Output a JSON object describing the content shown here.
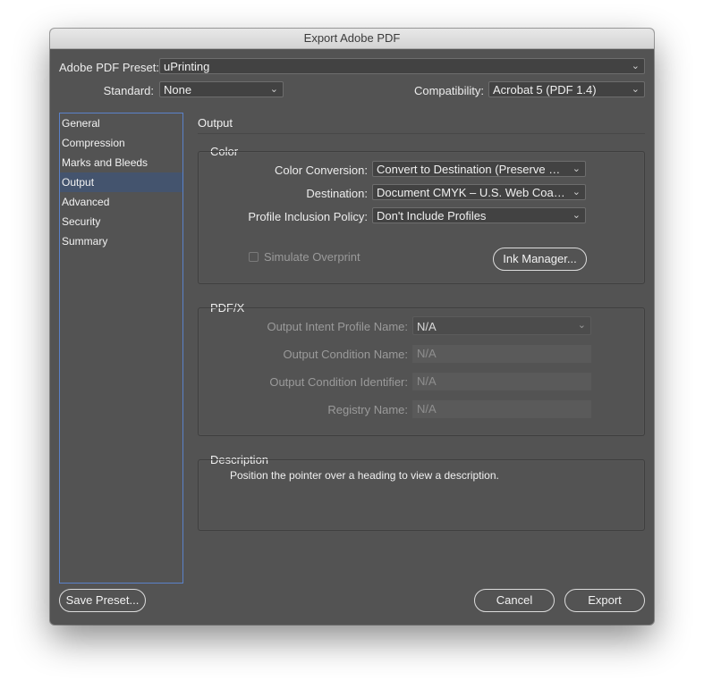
{
  "window": {
    "title": "Export Adobe PDF"
  },
  "preset": {
    "label": "Adobe PDF Preset:",
    "value": "uPrinting"
  },
  "standard": {
    "label": "Standard:",
    "value": "None"
  },
  "compatibility": {
    "label": "Compatibility:",
    "value": "Acrobat 5 (PDF 1.4)"
  },
  "sidebar": {
    "items": [
      {
        "label": "General"
      },
      {
        "label": "Compression"
      },
      {
        "label": "Marks and Bleeds"
      },
      {
        "label": "Output",
        "selected": true
      },
      {
        "label": "Advanced"
      },
      {
        "label": "Security"
      },
      {
        "label": "Summary"
      }
    ]
  },
  "panel": {
    "title": "Output"
  },
  "color_group": {
    "title": "Color",
    "conversion": {
      "label": "Color Conversion:",
      "value": "Convert to Destination (Preserve N..."
    },
    "destination": {
      "label": "Destination:",
      "value": "Document CMYK – U.S. Web Coate..."
    },
    "profile_policy": {
      "label": "Profile Inclusion Policy:",
      "value": "Don't Include Profiles"
    },
    "simulate_overprint": {
      "label": "Simulate Overprint",
      "checked": false,
      "enabled": false
    },
    "ink_manager_button": "Ink Manager..."
  },
  "pdfx_group": {
    "title": "PDF/X",
    "intent_profile": {
      "label": "Output Intent Profile Name:",
      "value": "N/A"
    },
    "condition_name": {
      "label": "Output Condition Name:",
      "value": "N/A"
    },
    "condition_identifier": {
      "label": "Output Condition Identifier:",
      "value": "N/A"
    },
    "registry_name": {
      "label": "Registry Name:",
      "value": "N/A"
    }
  },
  "description": {
    "title": "Description",
    "text": "Position the pointer over a heading to view a description."
  },
  "buttons": {
    "save_preset": "Save Preset...",
    "cancel": "Cancel",
    "export": "Export"
  },
  "colors": {
    "dialog_bg": "#535353",
    "selected_item": "#44546e",
    "sidebar_border": "#5b82c9"
  }
}
